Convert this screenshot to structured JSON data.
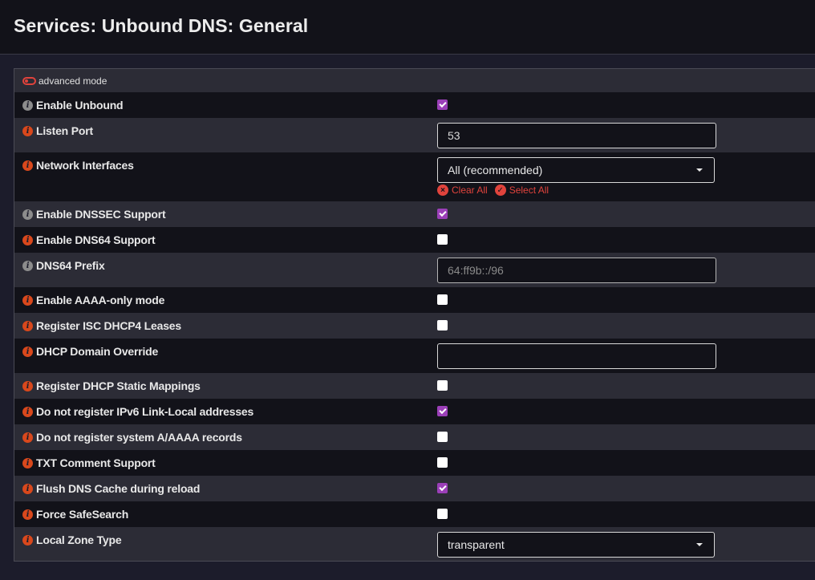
{
  "page": {
    "title": "Services: Unbound DNS: General"
  },
  "advanced_mode_label": "advanced mode",
  "rows": {
    "enable_unbound": {
      "label": "Enable Unbound",
      "checked": true
    },
    "listen_port": {
      "label": "Listen Port",
      "value": "53"
    },
    "network_interfaces": {
      "label": "Network Interfaces",
      "selected": "All (recommended)",
      "clear_all": "Clear All",
      "select_all": "Select All"
    },
    "enable_dnssec": {
      "label": "Enable DNSSEC Support",
      "checked": true
    },
    "enable_dns64": {
      "label": "Enable DNS64 Support",
      "checked": false
    },
    "dns64_prefix": {
      "label": "DNS64 Prefix",
      "placeholder": "64:ff9b::/96"
    },
    "aaaa_only": {
      "label": "Enable AAAA-only mode",
      "checked": false
    },
    "register_dhcp4": {
      "label": "Register ISC DHCP4 Leases",
      "checked": false
    },
    "dhcp_domain_override": {
      "label": "DHCP Domain Override",
      "value": ""
    },
    "register_static": {
      "label": "Register DHCP Static Mappings",
      "checked": false
    },
    "no_ipv6_linklocal": {
      "label": "Do not register IPv6 Link-Local addresses",
      "checked": true
    },
    "no_system_records": {
      "label": "Do not register system A/AAAA records",
      "checked": false
    },
    "txt_comment": {
      "label": "TXT Comment Support",
      "checked": false
    },
    "flush_cache": {
      "label": "Flush DNS Cache during reload",
      "checked": true
    },
    "force_safesearch": {
      "label": "Force SafeSearch",
      "checked": false
    },
    "local_zone_type": {
      "label": "Local Zone Type",
      "selected": "transparent"
    }
  },
  "colors": {
    "accent": "#e0433c",
    "checkbox_checked": "#9b3fb8",
    "info_gray": "#8c8c8c",
    "info_red": "#d9481c"
  },
  "icons": {
    "info": "info-icon",
    "toggle": "toggle-icon",
    "clear": "clear-icon",
    "check": "check-circle-icon",
    "caret": "caret-down-icon"
  }
}
